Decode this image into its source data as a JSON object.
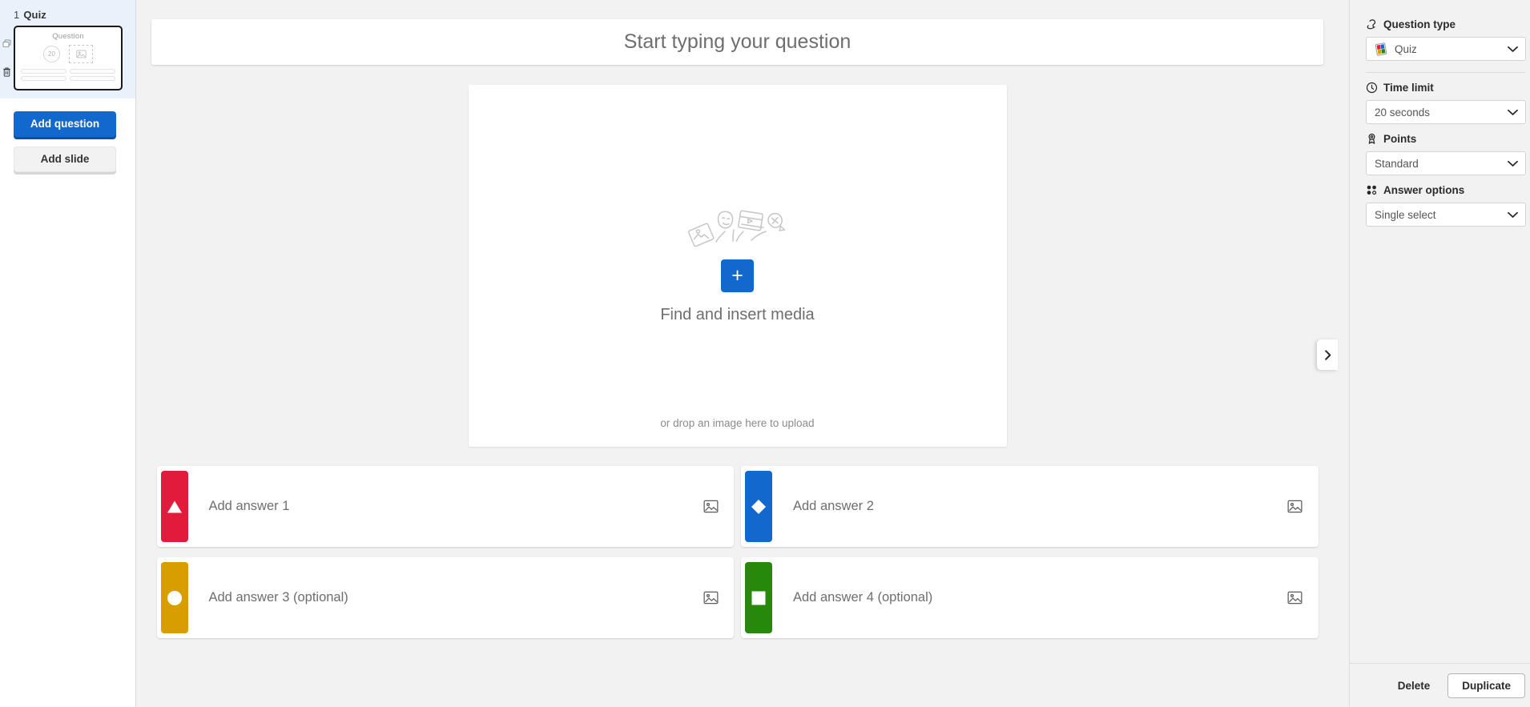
{
  "sidebar": {
    "slide_index": "1",
    "slide_type": "Quiz",
    "rail": {
      "duplicate_icon": "duplicate-icon",
      "delete_icon": "trash-icon"
    },
    "thumbnail": {
      "question_label": "Question",
      "timer_value": "20",
      "media_placeholder_icon": "image-icon",
      "answer_bar_count": 4
    },
    "add_question_label": "Add question",
    "add_slide_label": "Add slide"
  },
  "canvas": {
    "question_placeholder": "Start typing your question",
    "media": {
      "insert_label": "Find and insert media",
      "plus_label": "+",
      "drop_label": "or drop an image here to upload",
      "illustration_icons": [
        "image-card-icon",
        "theater-mask-icon",
        "film-strip-icon",
        "sticker-icon"
      ]
    },
    "answers": [
      {
        "placeholder": "Add answer 1",
        "shape": "triangle",
        "color": "#e21b3c",
        "image_icon": "image-icon"
      },
      {
        "placeholder": "Add answer 2",
        "shape": "diamond",
        "color": "#1368ce",
        "image_icon": "image-icon"
      },
      {
        "placeholder": "Add answer 3 (optional)",
        "shape": "circle",
        "color": "#d89e00",
        "image_icon": "image-icon"
      },
      {
        "placeholder": "Add answer 4 (optional)",
        "shape": "square",
        "color": "#26890c",
        "image_icon": "image-icon"
      }
    ]
  },
  "rightpanel": {
    "question_type": {
      "label": "Question type",
      "icon": "question-type-icon",
      "value": "Quiz",
      "value_icon": "quiz-grid-icon"
    },
    "time_limit": {
      "label": "Time limit",
      "icon": "clock-icon",
      "value": "20 seconds"
    },
    "points": {
      "label": "Points",
      "icon": "medal-icon",
      "value": "Standard"
    },
    "answer_options": {
      "label": "Answer options",
      "icon": "dot-grid-icon",
      "value": "Single select"
    },
    "delete_label": "Delete",
    "duplicate_label": "Duplicate",
    "collapse_icon": "chevron-right-icon"
  }
}
